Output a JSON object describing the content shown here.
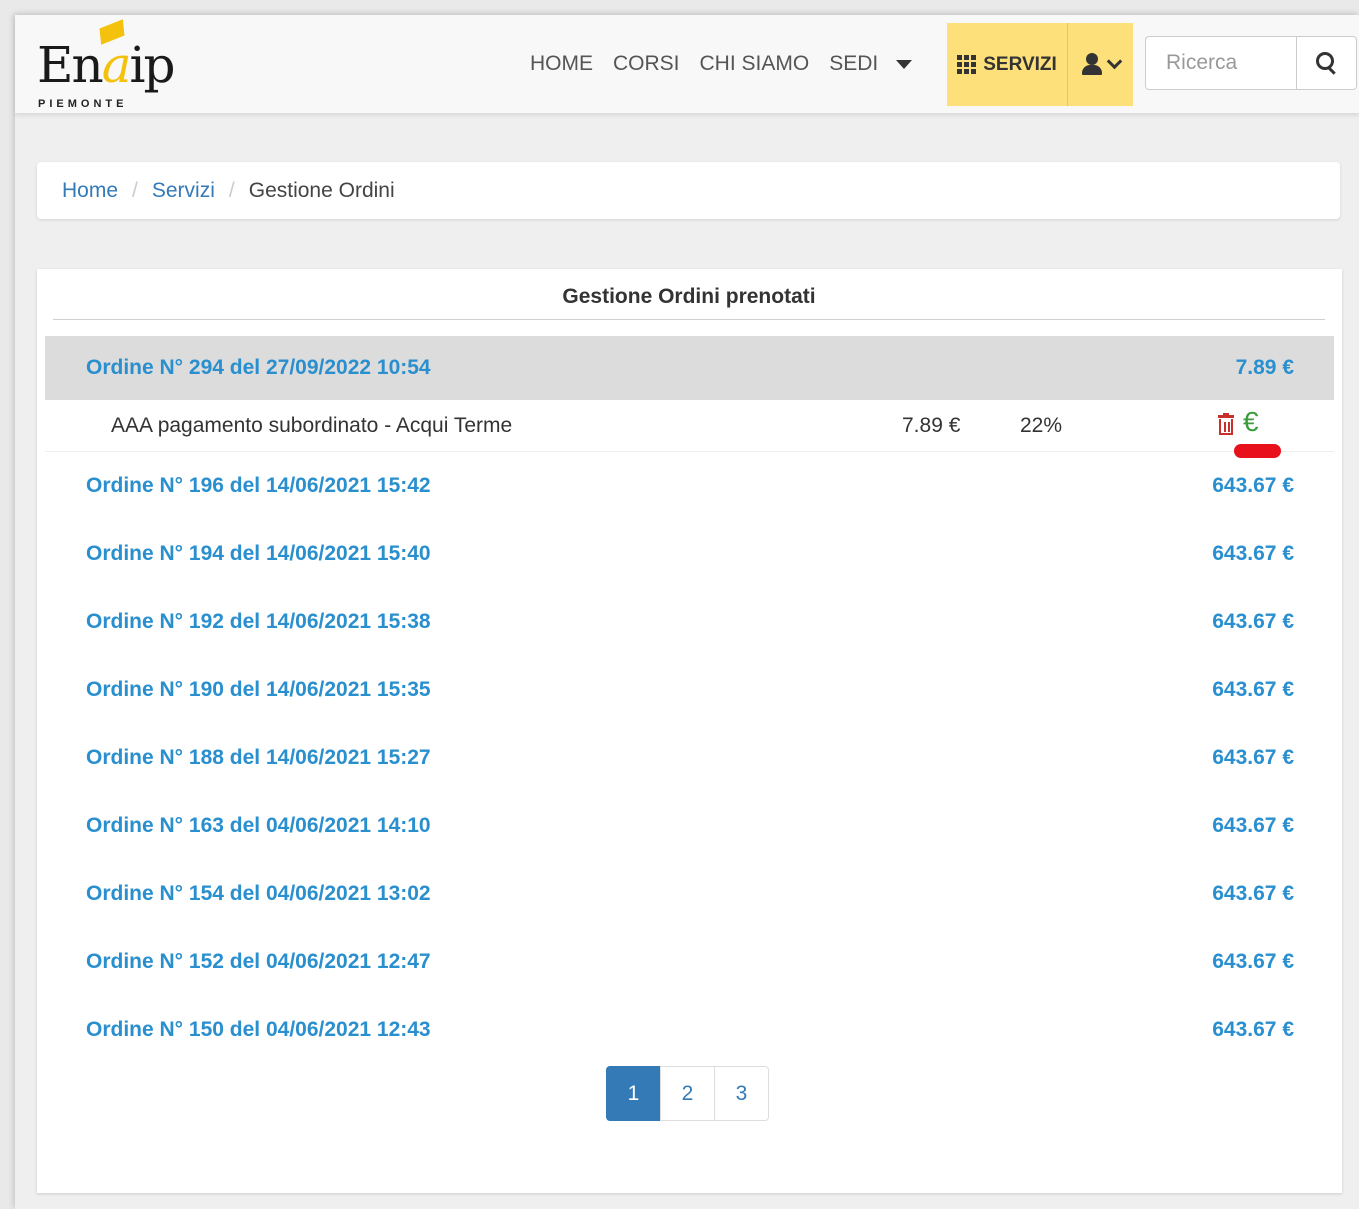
{
  "logo": {
    "word_pre": "En",
    "word_a": "a",
    "word_post": "ip",
    "sub": "PIEMONTE"
  },
  "nav": {
    "links": [
      "HOME",
      "CORSI",
      "CHI SIAMO",
      "SEDI"
    ],
    "servizi_label": "SERVIZI",
    "search_placeholder": "Ricerca",
    "accent_color": "#fde07a"
  },
  "breadcrumb": {
    "home": "Home",
    "servizi": "Servizi",
    "current": "Gestione Ordini"
  },
  "panel": {
    "title": "Gestione Ordini prenotati"
  },
  "orders": [
    {
      "label": "Ordine N° 294 del 27/09/2022 10:54",
      "total": "7.89 €"
    },
    {
      "label": "Ordine N° 196 del 14/06/2021 15:42",
      "total": "643.67 €"
    },
    {
      "label": "Ordine N° 194 del 14/06/2021 15:40",
      "total": "643.67 €"
    },
    {
      "label": "Ordine N° 192 del 14/06/2021 15:38",
      "total": "643.67 €"
    },
    {
      "label": "Ordine N° 190 del 14/06/2021 15:35",
      "total": "643.67 €"
    },
    {
      "label": "Ordine N° 188 del 14/06/2021 15:27",
      "total": "643.67 €"
    },
    {
      "label": "Ordine N° 163 del 04/06/2021 14:10",
      "total": "643.67 €"
    },
    {
      "label": "Ordine N° 154 del 04/06/2021 13:02",
      "total": "643.67 €"
    },
    {
      "label": "Ordine N° 152 del 04/06/2021 12:47",
      "total": "643.67 €"
    },
    {
      "label": "Ordine N° 150 del 04/06/2021 12:43",
      "total": "643.67 €"
    }
  ],
  "detail": {
    "description": "AAA pagamento subordinato - Acqui Terme",
    "price": "7.89 €",
    "vat": "22%",
    "pay_icon": "€"
  },
  "pagination": {
    "pages": [
      "1",
      "2",
      "3"
    ],
    "active": "1"
  }
}
